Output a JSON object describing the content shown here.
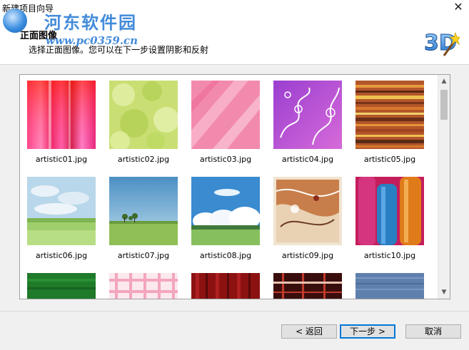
{
  "window": {
    "title": "新建项目向导",
    "close_glyph": "✕"
  },
  "watermark": {
    "site_name": "河东软件园",
    "site_url": "www.pc0359.cn"
  },
  "header": {
    "title": "正面图像",
    "subtitle": "选择正面图像。您可以在下一步设置阴影和反射"
  },
  "gallery": {
    "items": [
      {
        "file": "artistic01.jpg"
      },
      {
        "file": "artistic02.jpg"
      },
      {
        "file": "artistic03.jpg"
      },
      {
        "file": "artistic04.jpg"
      },
      {
        "file": "artistic05.jpg"
      },
      {
        "file": "artistic06.jpg"
      },
      {
        "file": "artistic07.jpg"
      },
      {
        "file": "artistic08.jpg"
      },
      {
        "file": "artistic09.jpg"
      },
      {
        "file": "artistic10.jpg"
      },
      {
        "file": ""
      },
      {
        "file": ""
      },
      {
        "file": ""
      },
      {
        "file": ""
      },
      {
        "file": ""
      }
    ],
    "scroll_up_glyph": "▲",
    "scroll_down_glyph": "▼"
  },
  "buttons": {
    "back": "< 返回",
    "next": "下一步 >",
    "cancel": "取消"
  }
}
